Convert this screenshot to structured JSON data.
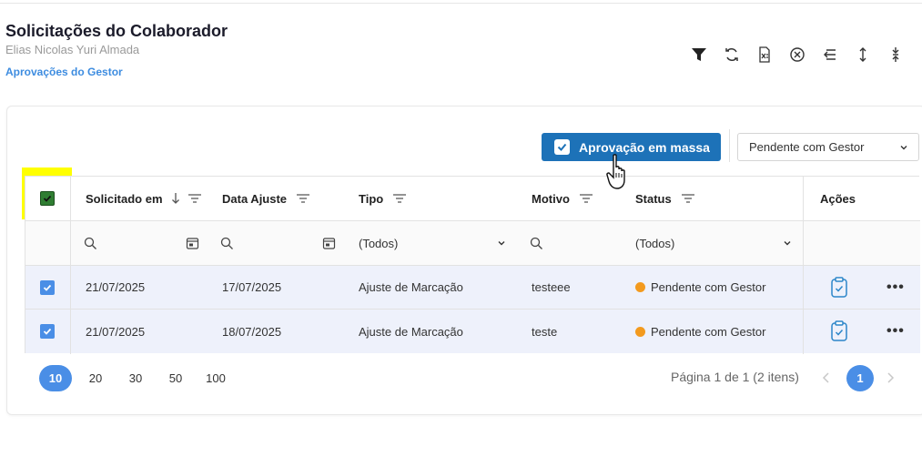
{
  "header": {
    "title": "Solicitações do Colaborador",
    "subtitle": "Elias Nicolas Yuri Almada",
    "link": "Aprovações do Gestor"
  },
  "toolbar": {
    "icons": [
      "filter-icon",
      "refresh-icon",
      "export-excel-icon",
      "clear-filter-icon",
      "collapse-icon",
      "expand-vertical-icon",
      "compress-vertical-icon"
    ]
  },
  "actions": {
    "mass_approval_label": "Aprovação em massa",
    "status_filter_value": "Pendente com Gestor"
  },
  "table": {
    "columns": [
      "Solicitado em",
      "Data Ajuste",
      "Tipo",
      "Motivo",
      "Status",
      "Ações"
    ],
    "filters": {
      "tipo": "(Todos)",
      "status": "(Todos)"
    },
    "rows": [
      {
        "solicitado": "21/07/2025",
        "data_ajuste": "17/07/2025",
        "tipo": "Ajuste de Marcação",
        "motivo": "testeee",
        "status": "Pendente com Gestor"
      },
      {
        "solicitado": "21/07/2025",
        "data_ajuste": "18/07/2025",
        "tipo": "Ajuste de Marcação",
        "motivo": "teste",
        "status": "Pendente com Gestor"
      }
    ]
  },
  "pager": {
    "sizes": [
      "10",
      "20",
      "30",
      "50",
      "100"
    ],
    "active_size": "10",
    "info": "Página 1 de 1 (2 itens)",
    "current_page": "1"
  },
  "colors": {
    "accent": "#1d72b8",
    "selected": "#4a8ee6",
    "pending": "#f39a1e",
    "highlight": "#ffff00"
  }
}
